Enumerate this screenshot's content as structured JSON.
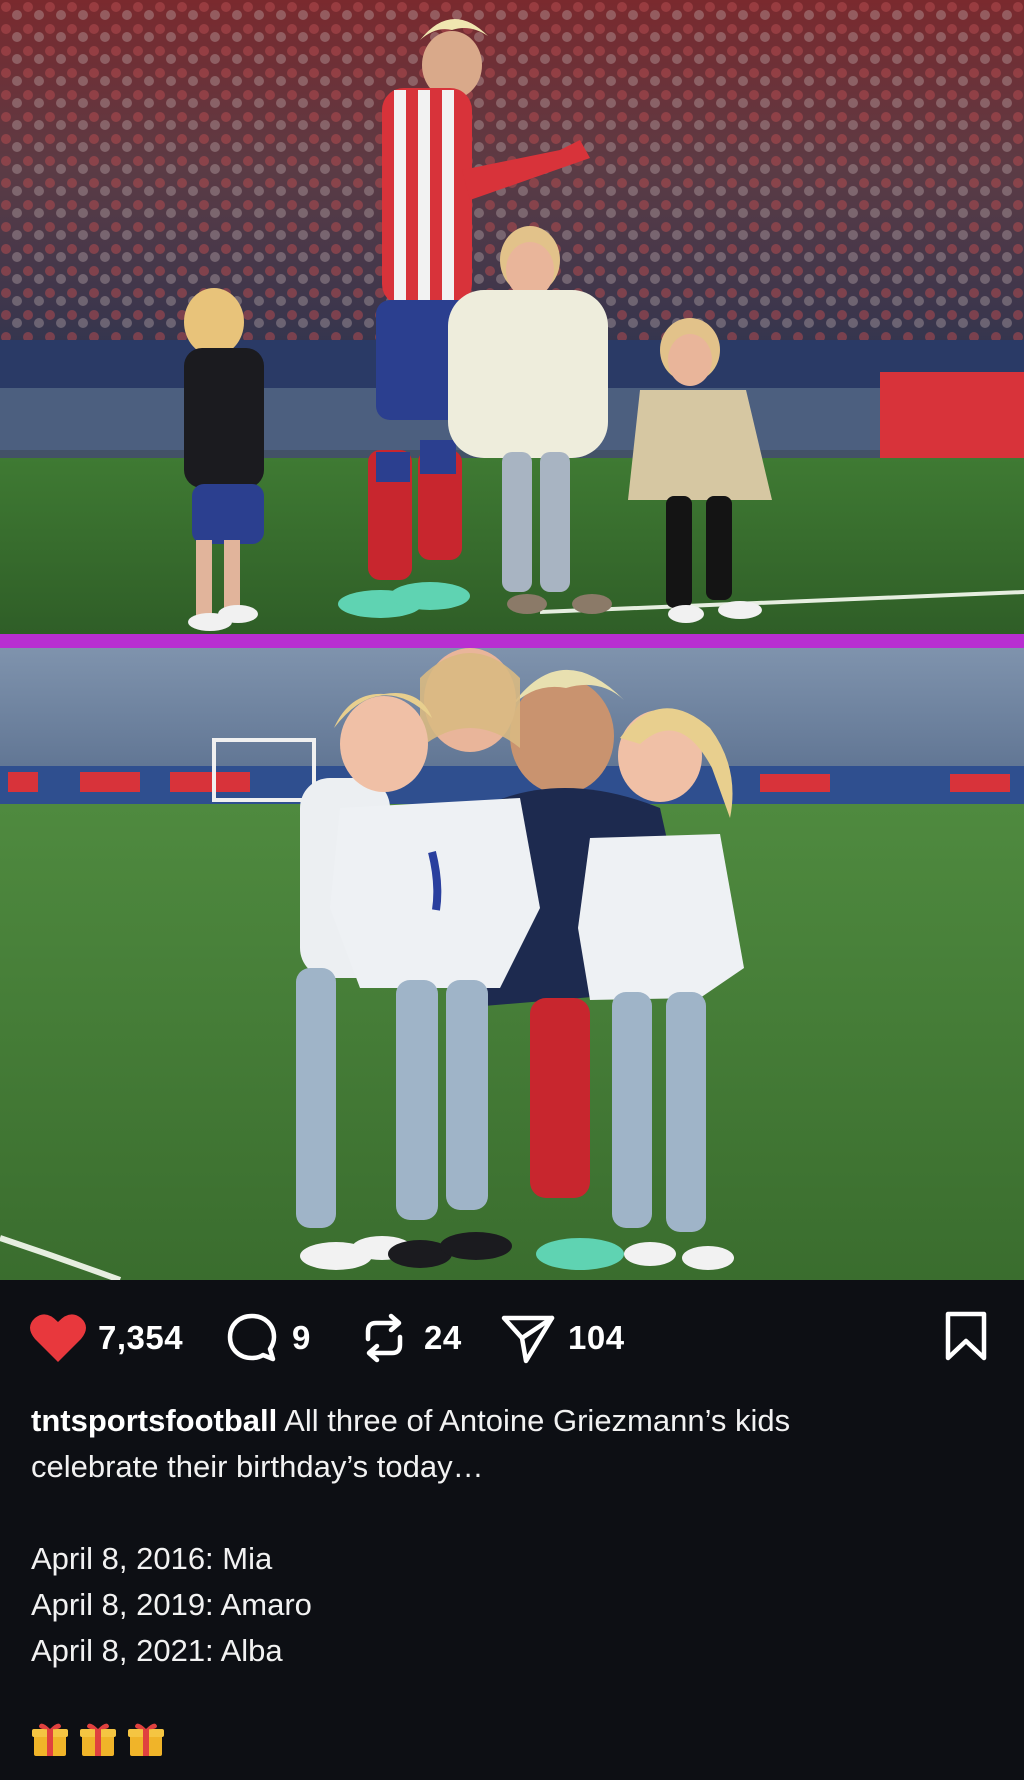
{
  "post": {
    "media": [
      {
        "alt_name": "photo-griezmann-stadium-kids"
      },
      {
        "alt_name": "photo-griezmann-hug-kids"
      }
    ],
    "actions": {
      "like": {
        "icon": "heart-icon",
        "count": "7,354",
        "color": "#e8383d"
      },
      "comment": {
        "icon": "comment-icon",
        "count": "9"
      },
      "repost": {
        "icon": "repost-icon",
        "count": "24"
      },
      "share": {
        "icon": "send-icon",
        "count": "104"
      },
      "save": {
        "icon": "bookmark-icon"
      }
    },
    "caption": {
      "username": "tntsportsfootball",
      "text_line1": " All three of Antoine Griezmann’s kids",
      "text_line2": "celebrate their birthday’s today…",
      "dates": [
        "April 8, 2016: Mia",
        "April 8, 2019: Amaro",
        "April 8, 2021: Alba"
      ],
      "emoji_icons": [
        "gift-icon",
        "gift-icon",
        "gift-icon"
      ]
    }
  },
  "theme": {
    "background": "#0d0f14",
    "divider": "#b82ed1"
  }
}
